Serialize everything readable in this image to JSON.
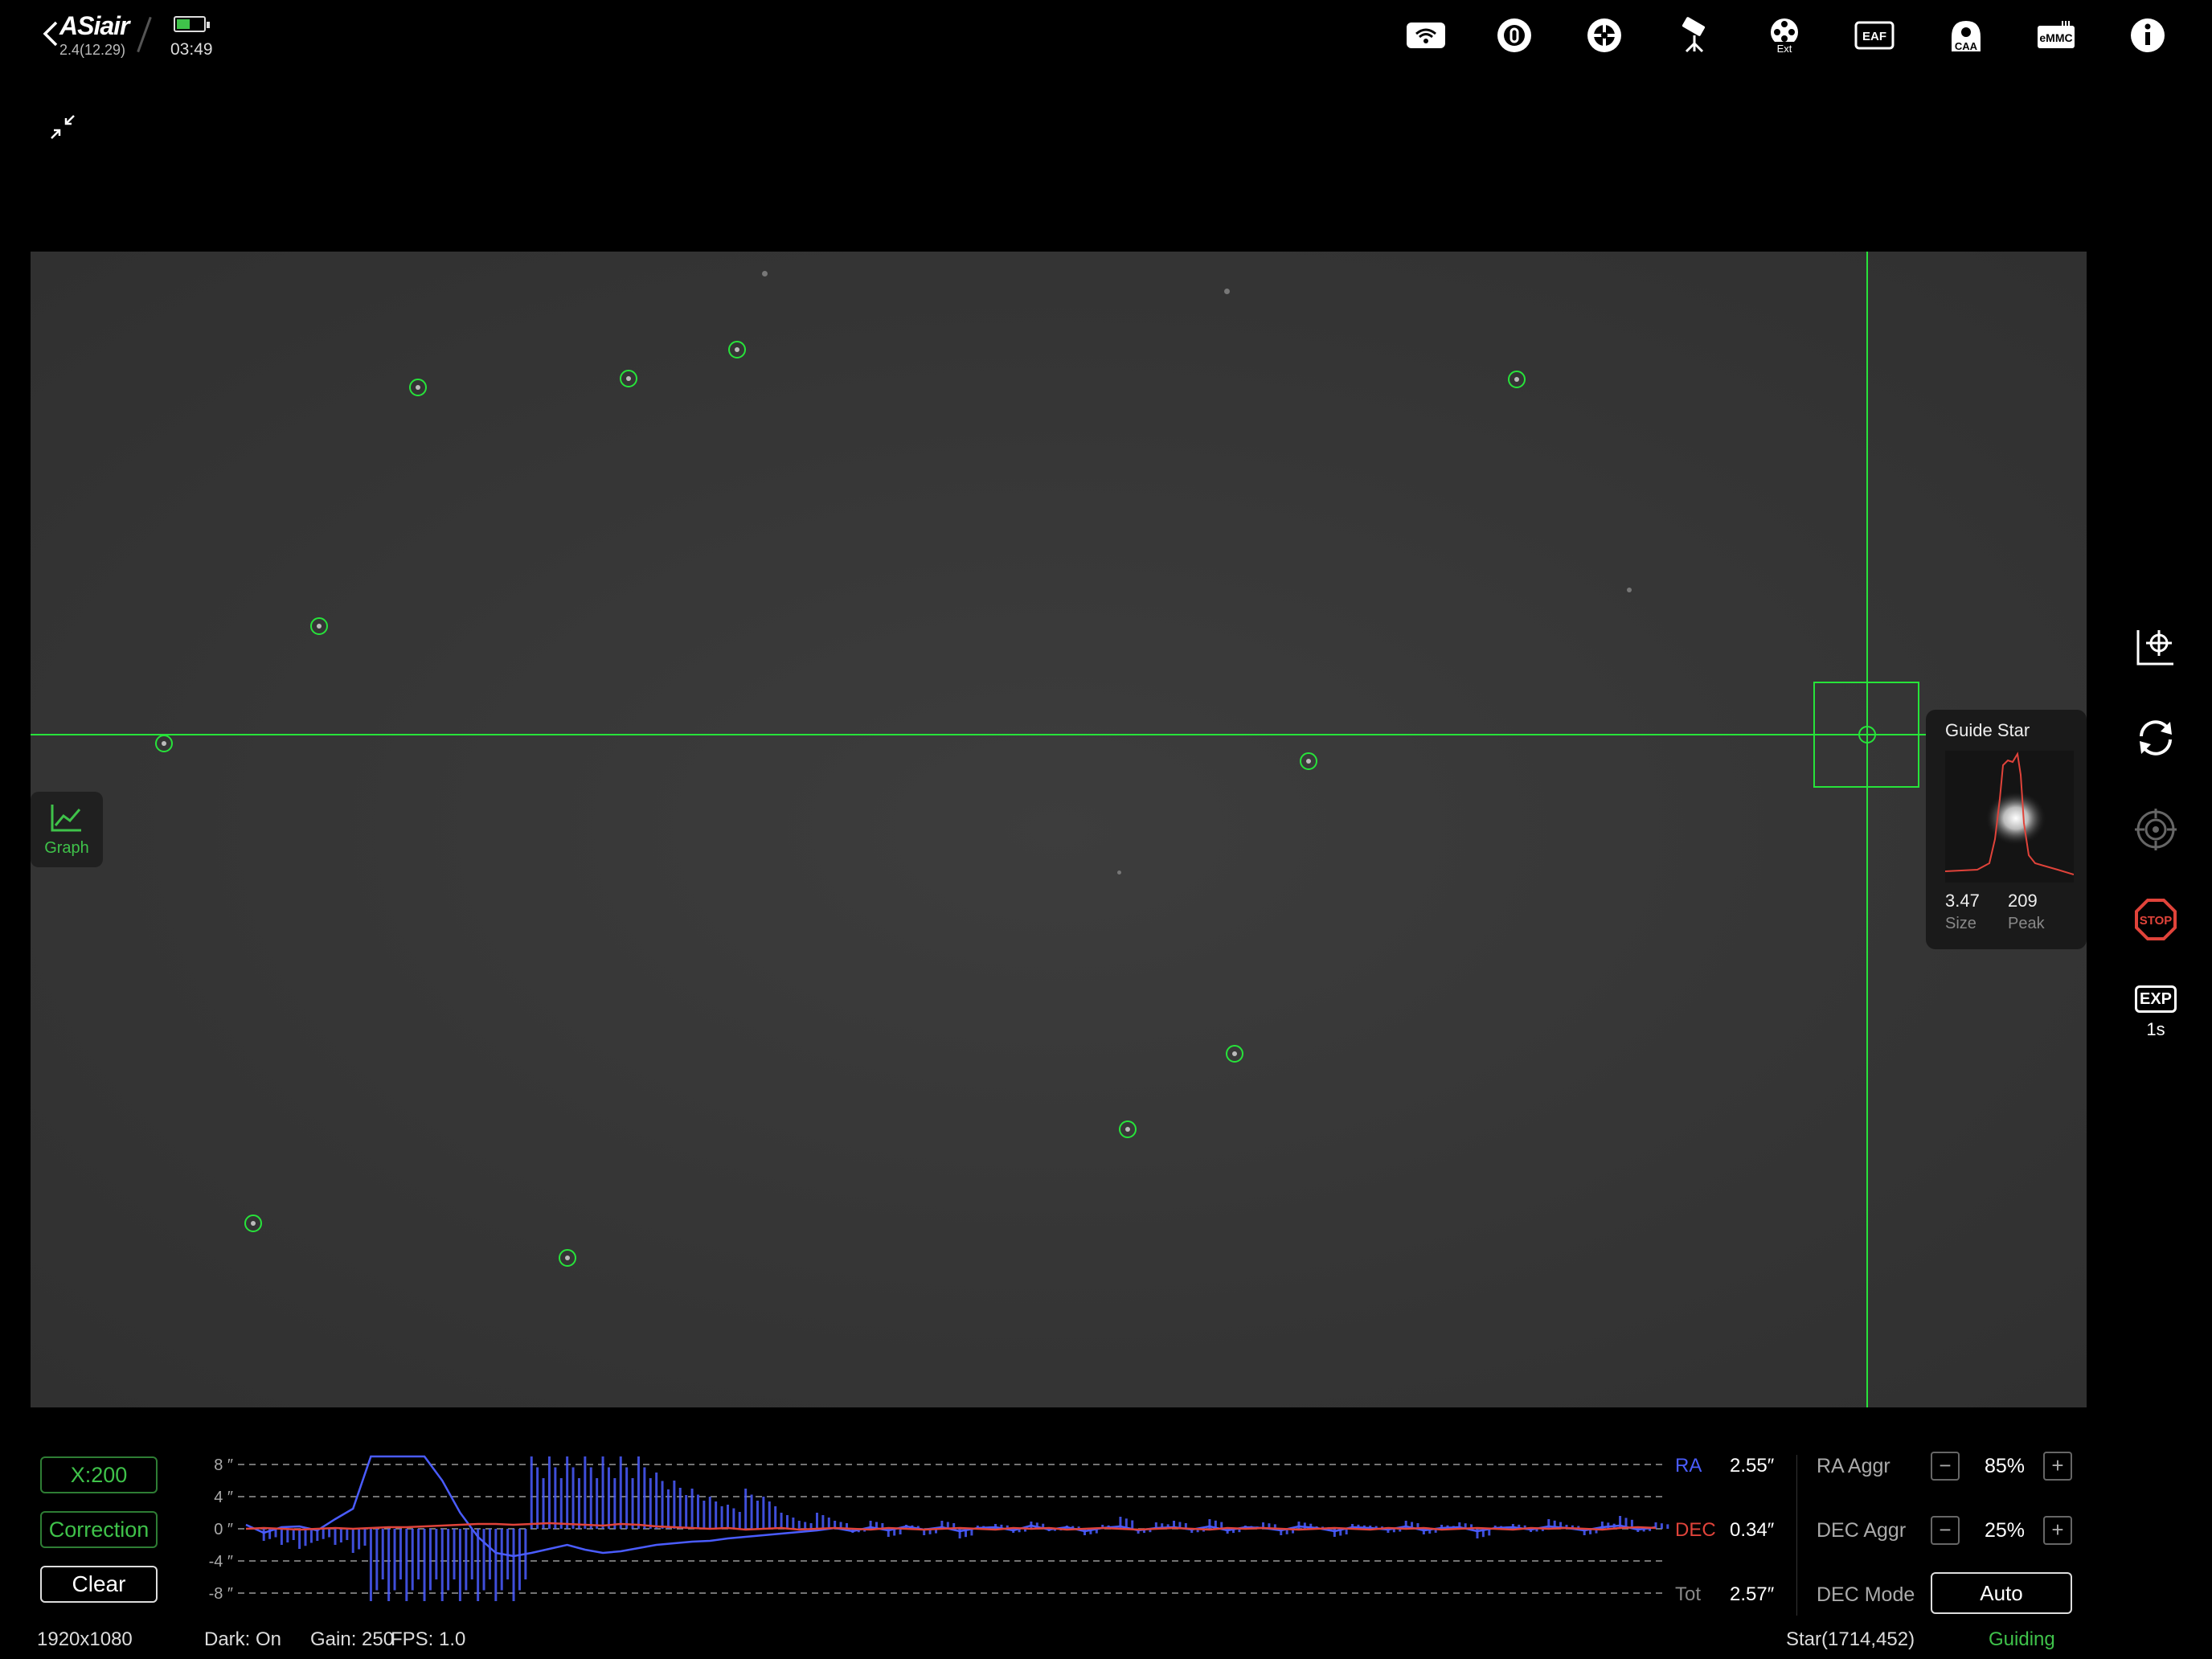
{
  "app": {
    "logo": "ASiair",
    "version": "2.4(12.29)",
    "time": "03:49",
    "battery_level": 0.5
  },
  "top_icons": [
    "wifi-icon",
    "camera-icon",
    "guide-camera-icon",
    "telescope-mount-icon",
    "filter-wheel-ext-icon",
    "eaf-icon",
    "caa-icon",
    "emmc-storage-icon",
    "info-icon"
  ],
  "top_icon_labels": {
    "ext": "Ext",
    "eaf": "EAF",
    "caa": "CAA",
    "emmc": "eMMC"
  },
  "graph_toggle": {
    "label": "Graph"
  },
  "guide_star": {
    "title": "Guide Star",
    "size_value": "3.47",
    "size_label": "Size",
    "peak_value": "209",
    "peak_label": "Peak"
  },
  "side_controls": {
    "exp_label": "EXP",
    "exp_value": "1s",
    "stop_label": "STOP"
  },
  "bottom": {
    "scale_button": "X:200",
    "correction_button": "Correction",
    "clear_button": "Clear",
    "ra_label": "RA",
    "ra_value": "2.55″",
    "dec_label": "DEC",
    "dec_value": "0.34″",
    "tot_label": "Tot",
    "tot_value": "2.57″",
    "ra_aggr_label": "RA Aggr",
    "ra_aggr_value": "85%",
    "dec_aggr_label": "DEC Aggr",
    "dec_aggr_value": "25%",
    "dec_mode_label": "DEC Mode",
    "dec_mode_value": "Auto",
    "minus": "−",
    "plus": "+"
  },
  "status_bar": {
    "resolution": "1920x1080",
    "dark": "Dark: On",
    "gain": "Gain: 250",
    "fps": "FPS: 1.0",
    "star": "Star(1714,452)",
    "state": "Guiding"
  },
  "colors": {
    "accent_green": "#3fc24a",
    "crosshair": "#27e33a",
    "ra": "#4a5cff",
    "dec": "#e0433a",
    "stop": "#e0433a"
  },
  "chart_data": {
    "type": "line",
    "yticks": [
      "8 ″",
      "4 ″",
      "0 ″",
      "-4 ″",
      "-8 ″"
    ],
    "ylim": [
      -9,
      9
    ],
    "series": [
      {
        "name": "RA",
        "values": [
          0.5,
          -0.5,
          0.2,
          0.3,
          -0.2,
          1.2,
          2.5,
          9,
          9,
          9,
          9,
          6,
          2,
          -1,
          -3,
          -3.4,
          -3,
          -2.5,
          -2,
          -2.6,
          -3,
          -2.8,
          -2.4,
          -2,
          -1.8,
          -1.6,
          -1.5,
          -1.2,
          -1,
          -0.8,
          -0.6,
          -0.4,
          -0.2,
          0.1,
          -0.3,
          0.2,
          -0.2,
          0.3,
          -0.1,
          0.2,
          -0.3,
          0.1,
          0.2,
          -0.2,
          0.4,
          -0.1,
          0.2,
          -0.3,
          0.1,
          0.3,
          -0.2,
          0.1,
          0.2,
          -0.1,
          0.3,
          -0.2,
          0.2,
          0.1,
          -0.2,
          0.3,
          0.1,
          -0.3,
          0.2,
          0.1,
          -0.1,
          0.3,
          -0.2,
          0.1,
          0.2,
          -0.3,
          0.1,
          0.2,
          -0.1,
          0.3,
          0.1,
          -0.2,
          0.2,
          0.4,
          -0.1,
          0.2
        ]
      },
      {
        "name": "DEC",
        "values": [
          0,
          0.1,
          0,
          -0.1,
          0,
          0.1,
          0,
          0.1,
          0.2,
          0.2,
          0.3,
          0.4,
          0.5,
          0.6,
          0.6,
          0.5,
          0.6,
          0.7,
          0.6,
          0.5,
          0.4,
          0.6,
          0.5,
          0.3,
          0.2,
          0.1,
          0,
          0.1,
          -0.1,
          0,
          0.1,
          -0.1,
          0,
          0.1,
          0,
          -0.1,
          0.1,
          0,
          -0.1,
          0,
          0.1,
          0,
          -0.1,
          0.1,
          0,
          0.1,
          -0.1,
          0,
          0.1,
          0,
          -0.1,
          0,
          0.1,
          0,
          -0.1,
          0.1,
          0,
          0.1,
          0,
          -0.1,
          0,
          0.1,
          0,
          -0.1,
          0.1,
          0,
          0.1,
          -0.1,
          0,
          0.1,
          0,
          -0.1,
          0.1,
          0,
          0.1,
          0,
          -0.1,
          0.1,
          0.2,
          0.1
        ]
      },
      {
        "name": "RA corrections",
        "values": [
          0,
          -1.5,
          -2,
          -2.5,
          -1.5,
          -2,
          -3,
          -9,
          -9,
          -9,
          -9,
          -9,
          -9,
          -9,
          -9,
          -9,
          9,
          9,
          9,
          9,
          9,
          9,
          9,
          7,
          6,
          5,
          4,
          3,
          5,
          4,
          2,
          1,
          2,
          1,
          -0.5,
          1,
          -1,
          0.5,
          -0.8,
          1,
          -1.2,
          0.4,
          0.6,
          -0.5,
          0.9,
          -0.3,
          0.4,
          -0.8,
          0.5,
          1.5,
          -0.6,
          0.8,
          1,
          -0.5,
          1.2,
          -0.6,
          0.4,
          0.8,
          -0.8,
          0.9,
          0.3,
          -1,
          0.6,
          0.4,
          -0.5,
          1,
          -0.7,
          0.5,
          0.8,
          -1.2,
          0.4,
          0.6,
          -0.4,
          1.2,
          0.5,
          -0.8,
          0.9,
          1.6,
          -0.4,
          0.8
        ]
      }
    ]
  }
}
